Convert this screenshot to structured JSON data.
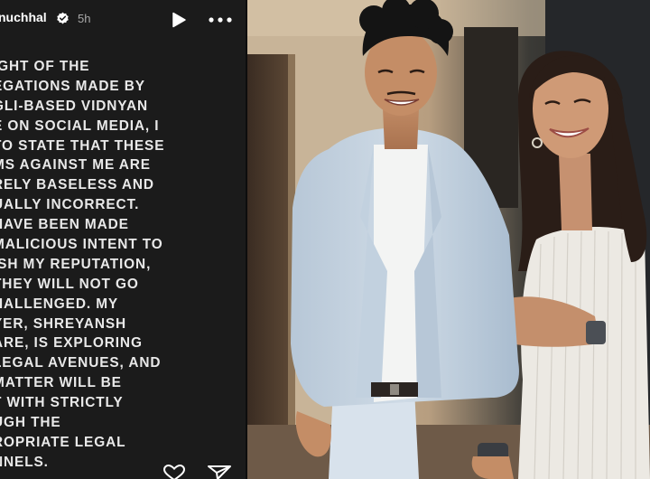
{
  "story": {
    "username": "nuchhal",
    "time": "5h",
    "icons": {
      "verified": "verified-badge-icon",
      "play": "play-icon",
      "more": "more-options-icon",
      "heart": "heart-icon",
      "send": "send-icon"
    },
    "statement_lines": [
      "IGHT OF THE",
      "EGATIONS MADE BY",
      "GLI-BASED VIDNYAN",
      "E ON SOCIAL MEDIA, I",
      "TO STATE THAT THESE",
      "MS AGAINST ME ARE",
      "RELY BASELESS AND",
      "UALLY INCORRECT.",
      "HAVE BEEN MADE",
      "MALICIOUS INTENT TO",
      "ISH MY REPUTATION,",
      "THEY WILL NOT GO",
      "HALLENGED. MY",
      "YER, SHREYANSH",
      "ARE, IS EXPLORING",
      "LEGAL AVENUES, AND",
      "MATTER WILL BE",
      "T WITH STRICTLY",
      "UGH THE",
      "ROPRIATE LEGAL",
      "NNELS."
    ]
  },
  "colors": {
    "panel_bg": "#1b1b1b",
    "text": "#e9e9e9",
    "verified_blue": "#3897f0"
  }
}
